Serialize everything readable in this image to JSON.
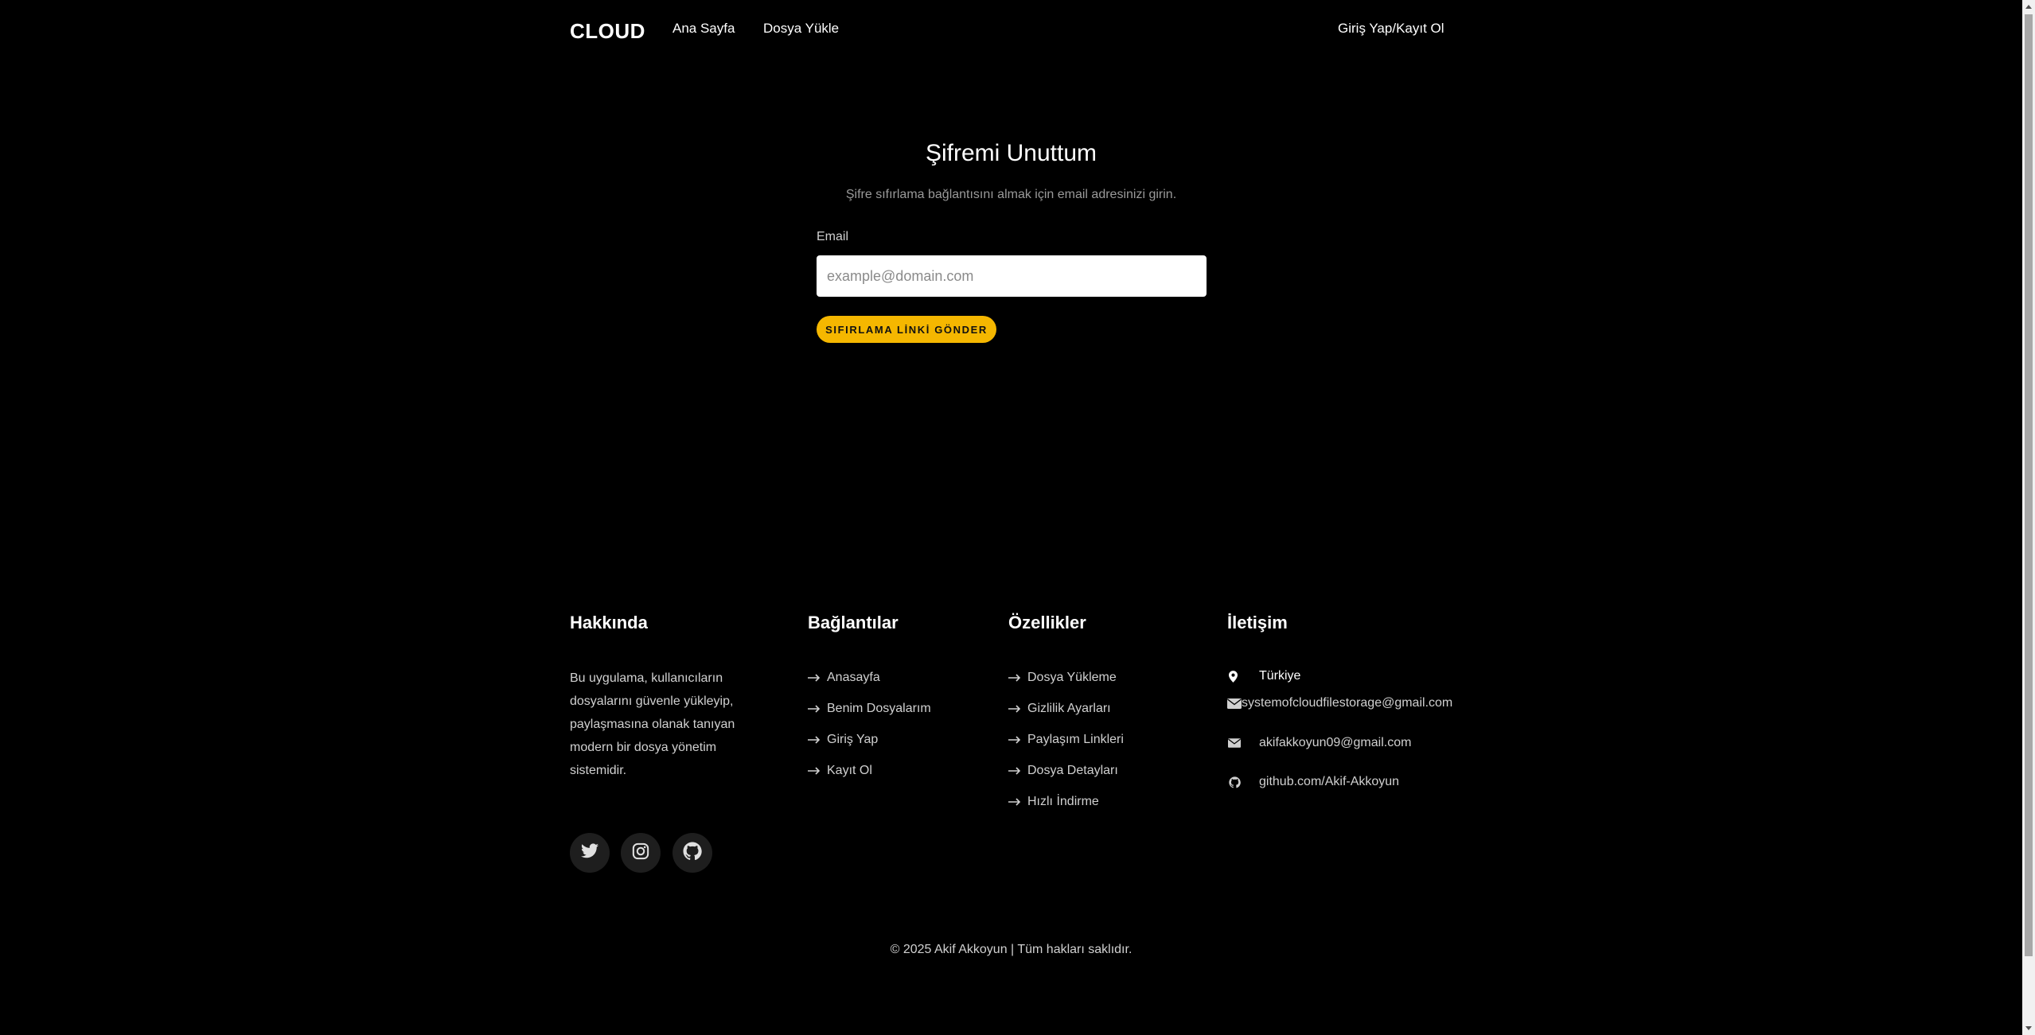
{
  "nav": {
    "logo": "CLOUD",
    "home": "Ana Sayfa",
    "upload": "Dosya Yükle",
    "login": "Giriş Yap/Kayıt Ol"
  },
  "form": {
    "title": "Şifremi Unuttum",
    "subtitle": "Şifre sıfırlama bağlantısını almak için email adresinizi girin.",
    "email_label": "Email",
    "email_placeholder": "example@domain.com",
    "email_value": "",
    "submit_label": "SIFIRLAMA LİNKİ GÖNDER"
  },
  "footer": {
    "about": {
      "heading": "Hakkında",
      "text": "Bu uygulama, kullanıcıların dosyalarını güvenle yükleyip, paylaşmasına olanak tanıyan modern bir dosya yönetim sistemidir."
    },
    "links": {
      "heading": "Bağlantılar",
      "items": [
        "Anasayfa",
        "Benim Dosyalarım",
        "Giriş Yap",
        "Kayıt Ol"
      ]
    },
    "features": {
      "heading": "Özellikler",
      "items": [
        "Dosya Yükleme",
        "Gizlilik Ayarları",
        "Paylaşım Linkleri",
        "Dosya Detayları",
        "Hızlı İndirme"
      ]
    },
    "contact": {
      "heading": "İletişim",
      "location": "Türkiye",
      "email1": "systemofcloudfilestorage@gmail.com",
      "email2": "akifakkoyun09@gmail.com",
      "github": "github.com/Akif-Akkoyun"
    },
    "social_icons": [
      "twitter-icon",
      "instagram-icon",
      "github-icon"
    ],
    "copyright": "© 2025 Akif Akkoyun | Tüm hakları saklıdır."
  },
  "colors": {
    "background": "#000000",
    "accent": "#f5b700",
    "muted_text": "#9a9a9a"
  }
}
